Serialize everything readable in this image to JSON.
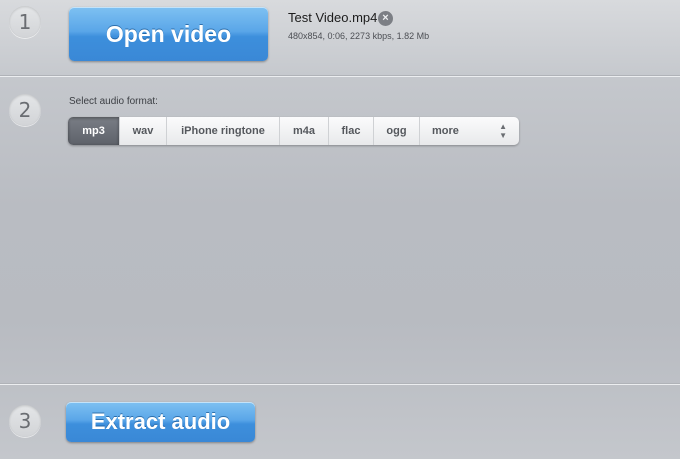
{
  "steps": {
    "one": "1",
    "two": "2",
    "three": "3"
  },
  "open_button": {
    "label": "Open video"
  },
  "file": {
    "name": "Test Video.mp4",
    "info": "480x854, 0:06, 2273 kbps, 1.82 Mb",
    "remove_icon": "x-circle-icon"
  },
  "format": {
    "label": "Select audio format:",
    "options": [
      "mp3",
      "wav",
      "iPhone ringtone",
      "m4a",
      "flac",
      "ogg",
      "more"
    ],
    "selected": "mp3",
    "more_icon": "updown-chevron-icon"
  },
  "extract_button": {
    "label": "Extract audio"
  },
  "colors": {
    "accent_blue": "#4a9be2",
    "selected_segment": "#6a6e76",
    "background": "#b9bcc2"
  }
}
